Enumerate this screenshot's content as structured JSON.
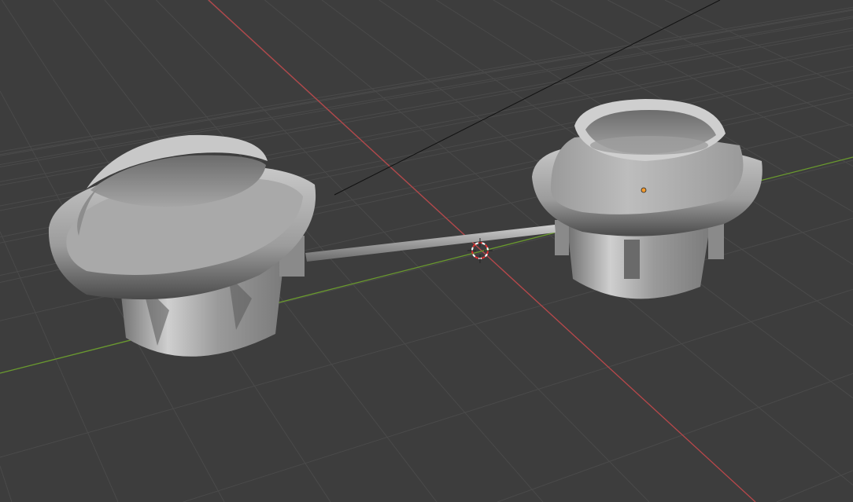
{
  "viewport": {
    "type": "3d-viewport",
    "background_color": "#3d3d3d",
    "grid_color": "#4a4a4a",
    "x_axis_color": "#b8474a",
    "y_axis_color": "#6a9a2e",
    "mesh_color": "#a8a8a8"
  },
  "scene": {
    "objects": [
      "left-cup",
      "right-cup",
      "connecting-rod"
    ],
    "icons": [
      "3d-cursor-icon",
      "object-origin-icon"
    ]
  }
}
